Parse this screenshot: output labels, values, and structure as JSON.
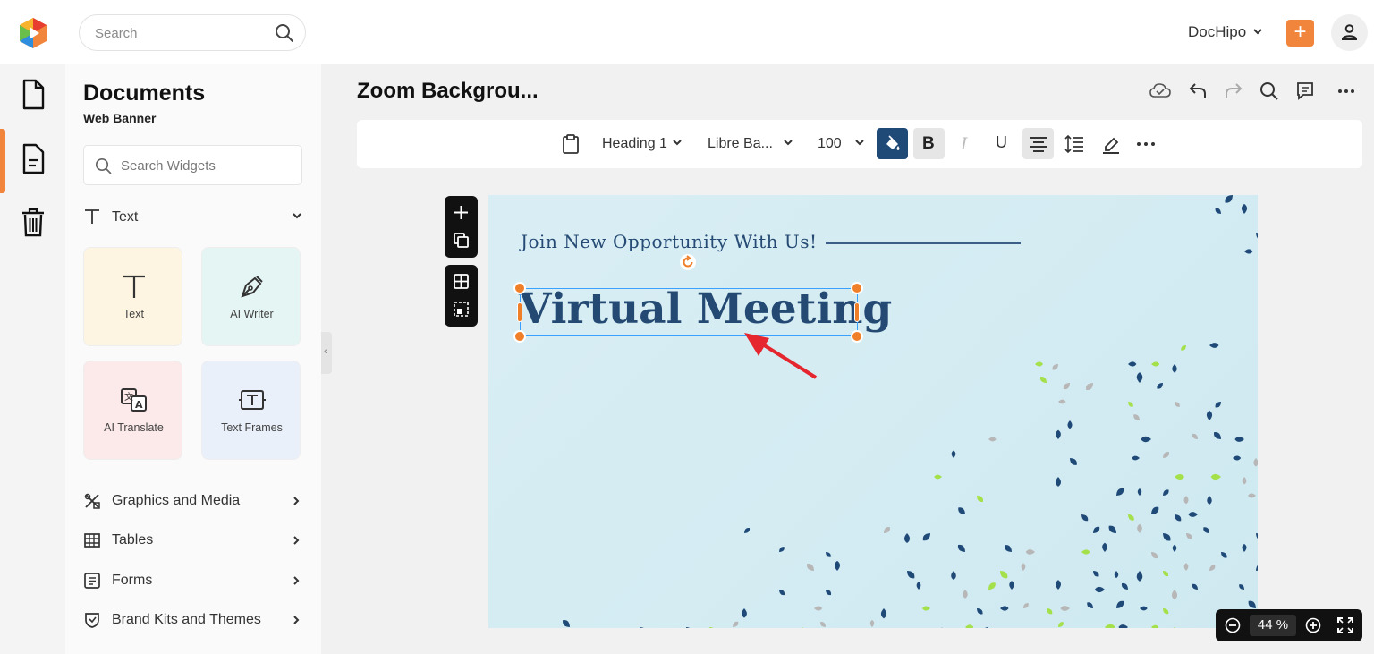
{
  "topbar": {
    "search_placeholder": "Search",
    "brand_label": "DocHipo",
    "add_label": "+"
  },
  "panel": {
    "title": "Documents",
    "subtitle": "Web Banner",
    "widget_search_placeholder": "Search Widgets",
    "text_section_label": "Text",
    "tiles": [
      {
        "label": "Text",
        "icon": "text-icon",
        "color": "#fdf5e2"
      },
      {
        "label": "AI Writer",
        "icon": "pen-nib-icon",
        "color": "#e5f5f4"
      },
      {
        "label": "AI Translate",
        "icon": "translate-icon",
        "color": "#fce9e9"
      },
      {
        "label": "Text Frames",
        "icon": "text-frame-icon",
        "color": "#e9f0fa"
      }
    ],
    "menu": [
      {
        "label": "Graphics and Media",
        "icon": "graphics-icon"
      },
      {
        "label": "Tables",
        "icon": "table-icon"
      },
      {
        "label": "Forms",
        "icon": "form-icon"
      },
      {
        "label": "Brand Kits and Themes",
        "icon": "brand-kit-icon"
      }
    ]
  },
  "editor": {
    "doc_title": "Zoom Backgrou...",
    "toolbar": {
      "text_style": "Heading 1",
      "font_family": "Libre Ba...",
      "font_size": "100"
    },
    "canvas": {
      "tagline": "Join New Opportunity With Us!",
      "headline": "Virtual Meeting",
      "background_color": "#d6ecf3",
      "accent_navy": "#1f4a78",
      "accent_green": "#a4e04a",
      "accent_gray": "#b7b7b7"
    },
    "zoom": {
      "value": "44",
      "unit": "%"
    }
  },
  "colors": {
    "accent_orange": "#f2853c",
    "selection_blue": "#3aa1ff",
    "active_tool_blue": "#1f4a78"
  }
}
